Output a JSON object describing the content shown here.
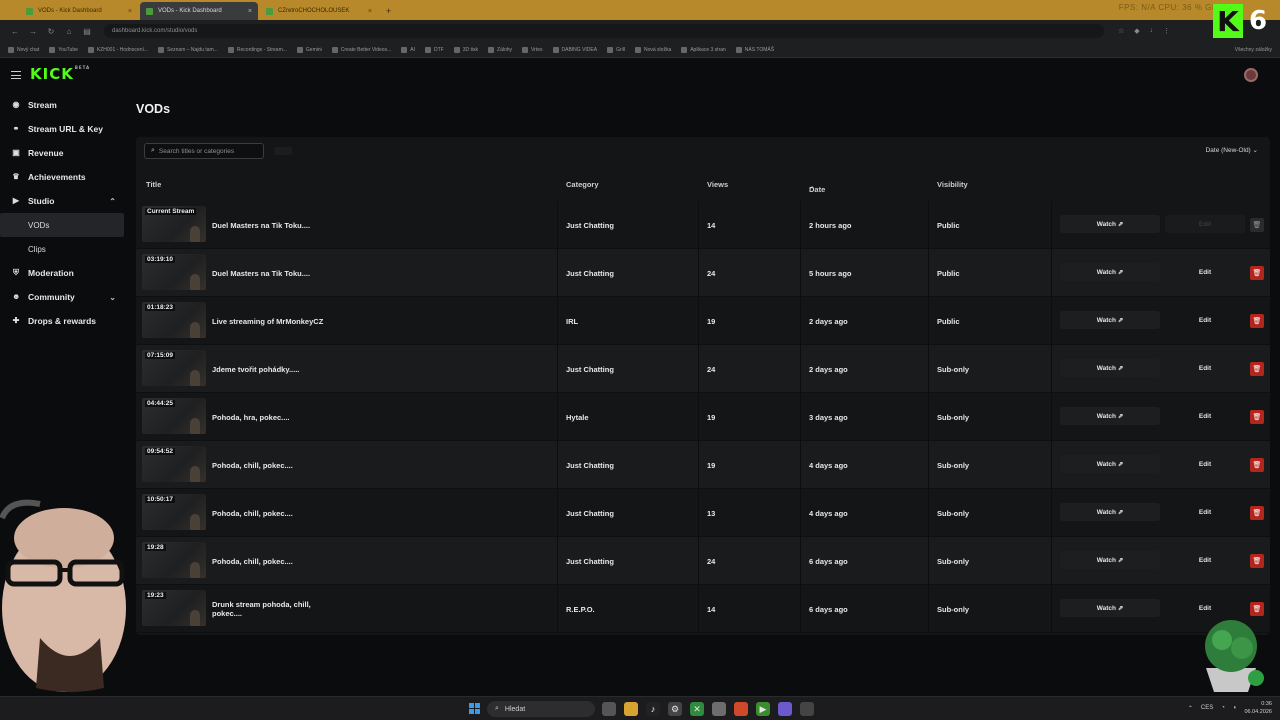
{
  "browser": {
    "tabs": [
      {
        "label": "VODs - Kick Dashboard",
        "active": false
      },
      {
        "label": "VODs - Kick Dashboard",
        "active": true
      },
      {
        "label": "CZretroCHOCHOLOUSEK",
        "active": false
      }
    ],
    "url": "dashboard.kick.com/studio/vods",
    "stats_overlay": "FPS: N/A    CPU: 36 %    GPU",
    "bookmarks": [
      "Nový chat",
      "YouTube",
      "KZH001 - Hodnocení...",
      "Seznam – Najdu tam...",
      "Recordings - Stream...",
      "Gemini",
      "Create Better Videos...",
      "AI",
      "DTF",
      "3D tisk",
      "Zálohy",
      "Vrtes",
      "DABING VIDEA",
      "Grill",
      "Nová složka",
      "Aplikace 3 stran",
      "NÁS TOMÁŠ"
    ],
    "bookmarks_right": "Všechny záložky"
  },
  "overlay": {
    "k_letter": "K",
    "count": "6"
  },
  "app": {
    "logo": "KICK",
    "logo_beta": "BETA",
    "sidebar": [
      {
        "label": "Stream",
        "icon": "broadcast-icon"
      },
      {
        "label": "Stream URL & Key",
        "icon": "link-icon"
      },
      {
        "label": "Revenue",
        "icon": "wallet-icon"
      },
      {
        "label": "Achievements",
        "icon": "trophy-icon"
      },
      {
        "label": "Studio",
        "icon": "video-icon",
        "expanded": true
      },
      {
        "label": "VODs",
        "sub": true,
        "active": true
      },
      {
        "label": "Clips",
        "sub": true
      },
      {
        "label": "Moderation",
        "icon": "shield-icon"
      },
      {
        "label": "Community",
        "icon": "people-icon",
        "expandable": true
      },
      {
        "label": "Drops & rewards",
        "icon": "gift-icon"
      }
    ],
    "page_title": "VODs",
    "search_placeholder": "Search titles or categories",
    "sort_label": "Date (New-Old)",
    "columns": {
      "title": "Title",
      "category": "Category",
      "views": "Views",
      "date": "Date",
      "visibility": "Visibility"
    },
    "watch_label": "Watch",
    "edit_label": "Edit",
    "rows": [
      {
        "duration": "Current Stream",
        "title": "Duel Masters na Tik Toku....",
        "category": "Just Chatting",
        "views": "14",
        "date": "2 hours ago",
        "visibility": "Public",
        "current": true
      },
      {
        "duration": "03:19:10",
        "title": "Duel Masters na Tik Toku....",
        "category": "Just Chatting",
        "views": "24",
        "date": "5 hours ago",
        "visibility": "Public"
      },
      {
        "duration": "01:18:23",
        "title": "Live streaming of MrMonkeyCZ",
        "category": "IRL",
        "views": "19",
        "date": "2 days ago",
        "visibility": "Public"
      },
      {
        "duration": "07:15:09",
        "title": "Jdeme tvořit pohádky.....",
        "category": "Just Chatting",
        "views": "24",
        "date": "2 days ago",
        "visibility": "Sub-only"
      },
      {
        "duration": "04:44:25",
        "title": "Pohoda, hra, pokec....",
        "category": "Hytale",
        "views": "19",
        "date": "3 days ago",
        "visibility": "Sub-only"
      },
      {
        "duration": "09:54:52",
        "title": "Pohoda, chill, pokec....",
        "category": "Just Chatting",
        "views": "19",
        "date": "4 days ago",
        "visibility": "Sub-only"
      },
      {
        "duration": "10:50:17",
        "title": "Pohoda, chill, pokec....",
        "category": "Just Chatting",
        "views": "13",
        "date": "4 days ago",
        "visibility": "Sub-only"
      },
      {
        "duration": "19:28",
        "title": "Pohoda, chill, pokec....",
        "category": "Just Chatting",
        "views": "24",
        "date": "6 days ago",
        "visibility": "Sub-only"
      },
      {
        "duration": "19:23",
        "title": "Drunk stream pohoda, chill, pokec....",
        "category": "R.E.P.O.",
        "views": "14",
        "date": "6 days ago",
        "visibility": "Sub-only"
      }
    ]
  },
  "taskbar": {
    "search_label": "Hledat",
    "lang": "CES",
    "time": "0:36",
    "date": "06.04.2026"
  },
  "colors": {
    "kick_green": "#53fc18",
    "delete_red": "#b3261e",
    "tabbar": "#b8892a"
  }
}
